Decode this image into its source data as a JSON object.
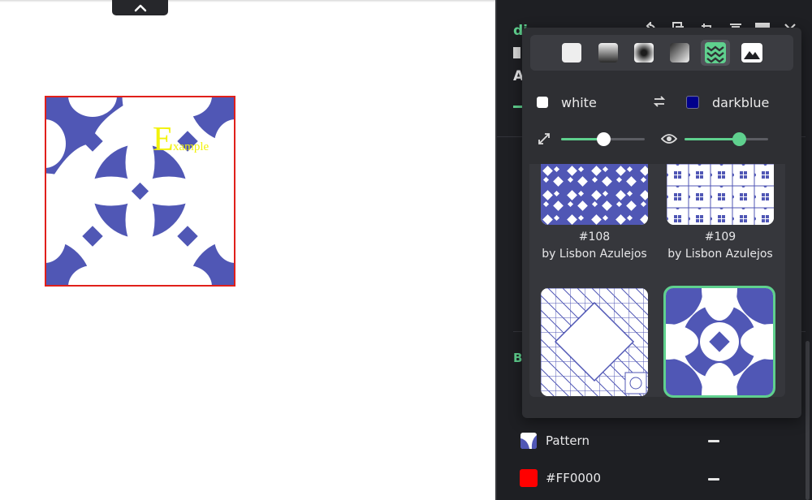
{
  "canvas": {
    "sample_text": {
      "big": "E",
      "small": "xample"
    },
    "collapse_icon": "chevron-up-icon"
  },
  "panel": {
    "heading_letters": [
      "di",
      "A",
      "B"
    ],
    "toolbar_icons": [
      "rotate-icon",
      "copy-icon",
      "crop-icon",
      "delete-icon",
      "layout-icon",
      "close-icon"
    ]
  },
  "fill_popup": {
    "fill_types": [
      {
        "name": "solid",
        "icon": "solid-fill-icon",
        "active": false
      },
      {
        "name": "linear-gradient",
        "icon": "linear-gradient-icon",
        "active": false
      },
      {
        "name": "radial-gradient",
        "icon": "radial-gradient-icon",
        "active": false
      },
      {
        "name": "diagonal-gradient",
        "icon": "diagonal-gradient-icon",
        "active": false
      },
      {
        "name": "pattern",
        "icon": "pattern-fill-icon",
        "active": true
      },
      {
        "name": "image",
        "icon": "image-fill-icon",
        "active": false
      }
    ],
    "color_a": {
      "label": "white",
      "hex": "#FFFFFF"
    },
    "swap_icon": "swap-icon",
    "color_b": {
      "label": "darkblue",
      "hex": "#00008B"
    },
    "scale_slider": {
      "icon": "scale-icon",
      "value": 0.5
    },
    "opacity_slider": {
      "icon": "eye-icon",
      "value": 0.65
    },
    "patterns": [
      {
        "number": "#108",
        "author": "by Lisbon Azulejos",
        "selected": false
      },
      {
        "number": "#109",
        "author": "by Lisbon Azulejos",
        "selected": false
      },
      {
        "number": "",
        "author": "",
        "selected": false
      },
      {
        "number": "",
        "author": "",
        "selected": true
      }
    ]
  },
  "layers": [
    {
      "label": "Pattern",
      "swatch": "pattern-swatch-icon",
      "color": "#5057B5"
    },
    {
      "label": "#FF0000",
      "swatch": "color-swatch",
      "color": "#FF0000"
    }
  ],
  "colors": {
    "accent": "#5FD08E",
    "tile_blue": "#5057B5",
    "outline_red": "#E0201B",
    "panel_bg": "#1E1F23",
    "popup_bg": "#2E2F33",
    "sample_text_yellow": "#F2F20C"
  }
}
